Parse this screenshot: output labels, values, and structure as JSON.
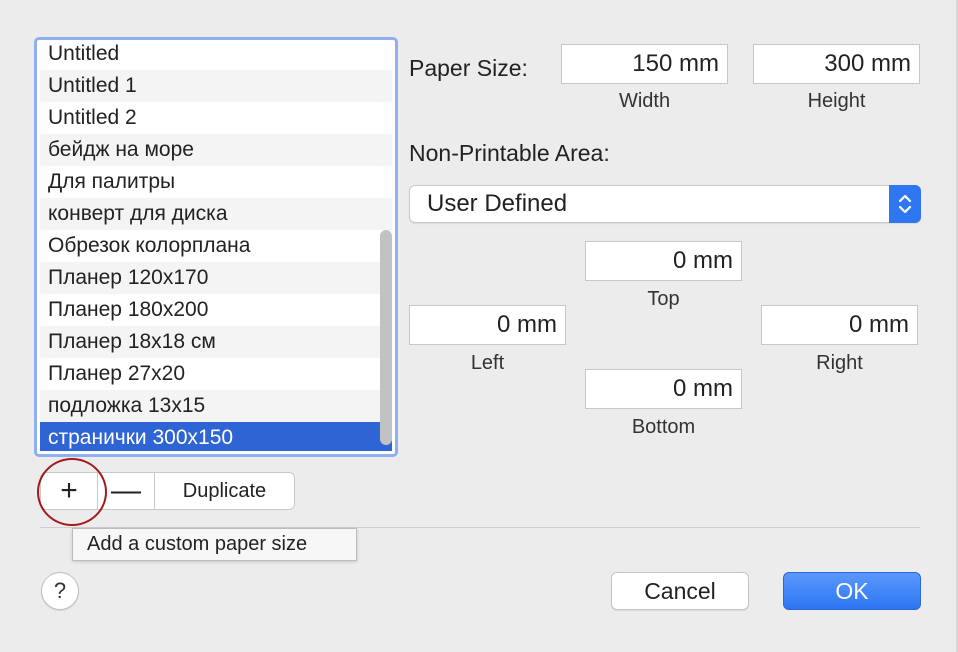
{
  "list": {
    "items": [
      "Untitled",
      "Untitled 1",
      "Untitled 2",
      "бейдж на море",
      "Для палитры",
      "конверт для диска",
      "Обрезок колорплана",
      "Планер 120x170",
      "Планер 180x200",
      "Планер 18x18 см",
      "Планер 27x20",
      "подложка 13x15",
      "странички 300x150"
    ],
    "selected_index": 12
  },
  "buttons": {
    "add": "+",
    "remove": "—",
    "duplicate": "Duplicate",
    "help": "?",
    "cancel": "Cancel",
    "ok": "OK"
  },
  "tooltip": "Add a custom paper size",
  "paper_size": {
    "label": "Paper Size:",
    "width_value": "150 mm",
    "width_label": "Width",
    "height_value": "300 mm",
    "height_label": "Height"
  },
  "non_printable": {
    "label": "Non-Printable Area:",
    "selected": "User Defined",
    "top_value": "0 mm",
    "top_label": "Top",
    "left_value": "0 mm",
    "left_label": "Left",
    "right_value": "0 mm",
    "right_label": "Right",
    "bottom_value": "0 mm",
    "bottom_label": "Bottom"
  },
  "colors": {
    "selection": "#2f64d4",
    "accent": "#2f77f0",
    "highlight_circle": "#a6191b"
  }
}
